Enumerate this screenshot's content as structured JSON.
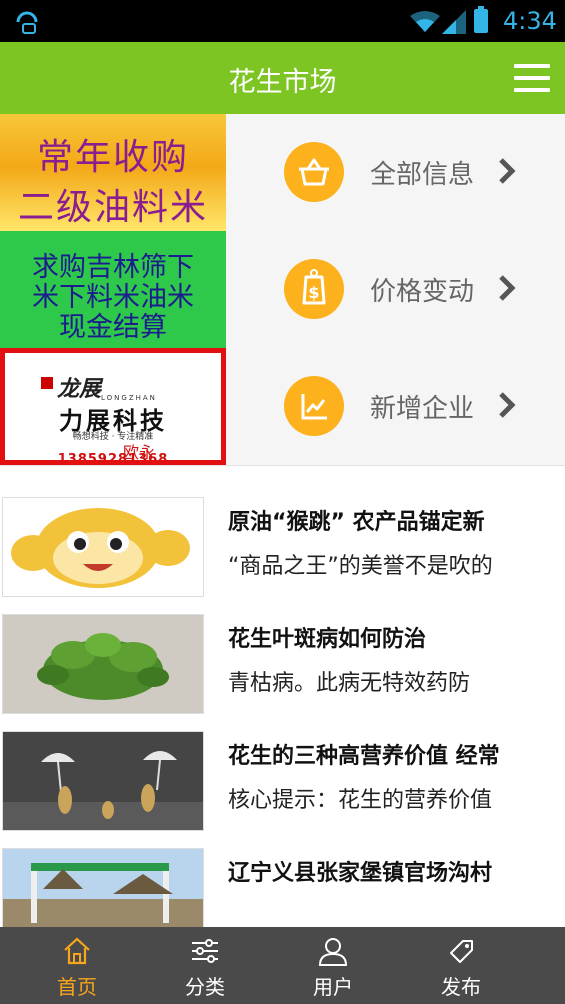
{
  "status_bar": {
    "time": "4:34"
  },
  "header": {
    "title": "花生市场",
    "menu_icon": "hamburger-menu-icon"
  },
  "banners": [
    {
      "ad": {
        "lines": [
          "常年收购",
          "二级油料米"
        ]
      },
      "category": {
        "label": "全部信息",
        "icon": "basket-icon"
      }
    },
    {
      "ad": {
        "lines": [
          "求购吉林筛下",
          "米下料米油米",
          "现金结算"
        ]
      },
      "category": {
        "label": "价格变动",
        "icon": "price-tag-icon"
      }
    },
    {
      "ad": {
        "brand": "龙展",
        "brand_sub": "LONGZHAN",
        "company": "力展科技",
        "slogan": "畅想科技 · 专注精准",
        "person": "欧永",
        "phone": "13859281368"
      },
      "category": {
        "label": "新增企业",
        "icon": "line-chart-icon"
      }
    }
  ],
  "news": [
    {
      "title": "原油“猴跳”   农产品锚定新",
      "summary": "“商品之王”的美誉不是吹的"
    },
    {
      "title": "花生叶斑病如何防治",
      "summary": "青枯病。此病无特效药防"
    },
    {
      "title": "花生的三种高营养价值 经常",
      "summary": "核心提示：花生的营养价值"
    },
    {
      "title": "辽宁义县张家堡镇官场沟村",
      "summary": ""
    }
  ],
  "tabs": [
    {
      "label": "首页",
      "icon": "home-icon",
      "active": true
    },
    {
      "label": "分类",
      "icon": "sliders-icon",
      "active": false
    },
    {
      "label": "用户",
      "icon": "user-icon",
      "active": false
    },
    {
      "label": "发布",
      "icon": "tag-icon",
      "active": false
    }
  ],
  "colors": {
    "header_bg": "#7dc523",
    "icon_circle": "#fdb11d",
    "tab_bg": "#4a4a4a",
    "tab_active": "#f7a51c"
  }
}
